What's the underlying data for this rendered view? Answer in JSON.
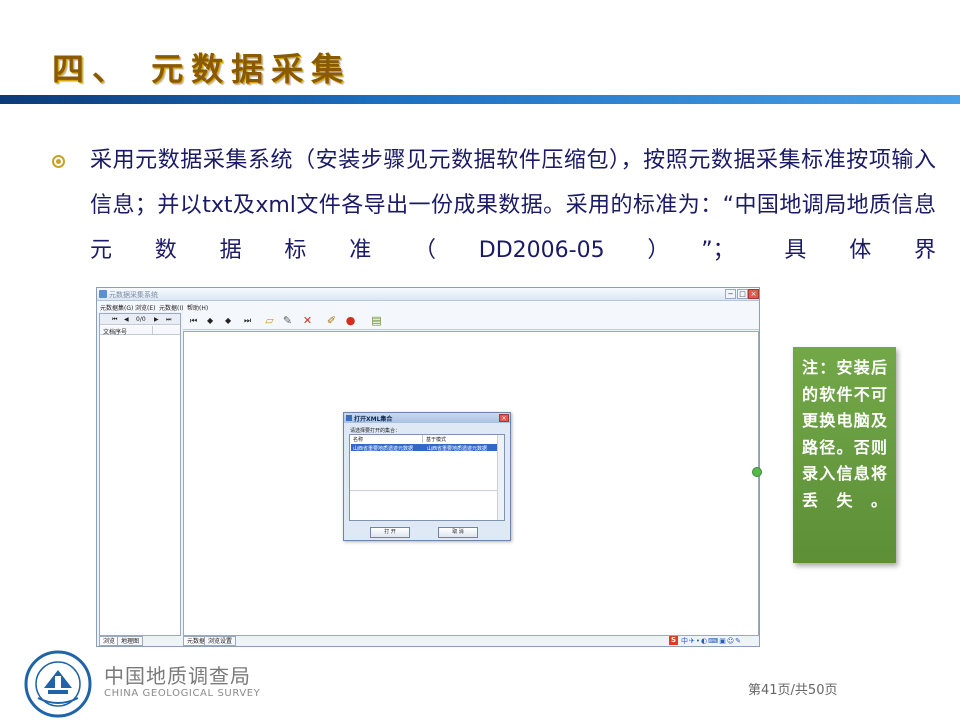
{
  "slide": {
    "title": "四、 元数据采集",
    "bullet": "采用元数据采集系统（安装步骤见元数据软件压缩包），按照元数据采集标准按项输入信息；并以txt及xml文件各导出一份成果数据。采用的标准为：“中国地调局地质信息元数据标准（DD2006-05）”； 具体界",
    "note": "注：安装后的软件不可更换电脑及路径。否则录入信息将丢失。",
    "page_number": "第41页/共50页",
    "colors": {
      "title": "#8a5a00",
      "bar": "#1c6fc0",
      "body_text": "#1a1a66",
      "note_bg": "#6a9e40"
    }
  },
  "footer": {
    "org_cn": "中国地质调查局",
    "org_en": "CHINA GEOLOGICAL SURVEY",
    "logo_icon": "cgs-seal-icon"
  },
  "app": {
    "window_title": "元数据采集系统",
    "menu": [
      "元数据集(G)",
      "浏览(E)",
      "元数据(I)",
      "帮助(H)"
    ],
    "nav": {
      "count": "0/0"
    },
    "list_header": "文档序号",
    "left_tabs": [
      "浏览",
      "地理图"
    ],
    "main_tabs": [
      "元数据",
      "浏览设置"
    ],
    "toolbar_icons": [
      "first-icon",
      "prev-icon",
      "next-icon",
      "last-icon",
      "open-folder-icon",
      "tools-icon",
      "delete-icon",
      "edit-icon",
      "stop-icon",
      "document-icon"
    ],
    "dialog": {
      "title": "打开XML集合",
      "prompt": "请选择要打开的集合：",
      "col_name": "名称",
      "col_mode": "基于模式",
      "selected_row_name": "山西省重要地质遗迹元数据",
      "selected_row_mode": "山西省重要地质遗迹元数据",
      "ok_label": "打 开",
      "cancel_label": "取 消"
    }
  }
}
